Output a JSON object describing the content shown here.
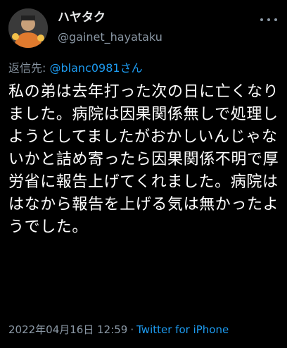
{
  "author": {
    "display_name": "ハヤタク",
    "handle": "@gainet_hayataku",
    "avatar_icon": "user-avatar-icon"
  },
  "reply": {
    "prefix": "返信先:",
    "target": "@blanc0981さん"
  },
  "tweet": {
    "text": "私の弟は去年打った次の日に亡くなりました。病院は因果関係無しで処理しようとしてましたがおかしいんじゃないかと詰め寄ったら因果関係不明で厚労省に報告上げてくれました。病院ははなから報告を上げる気は無かったようでした。"
  },
  "meta": {
    "timestamp": "2022年04月16日 12:59",
    "separator": "·",
    "source": "Twitter for iPhone"
  },
  "colors": {
    "background": "#000000",
    "text": "#ffffff",
    "secondary": "#8b98a5",
    "accent": "#1d9bf0"
  }
}
